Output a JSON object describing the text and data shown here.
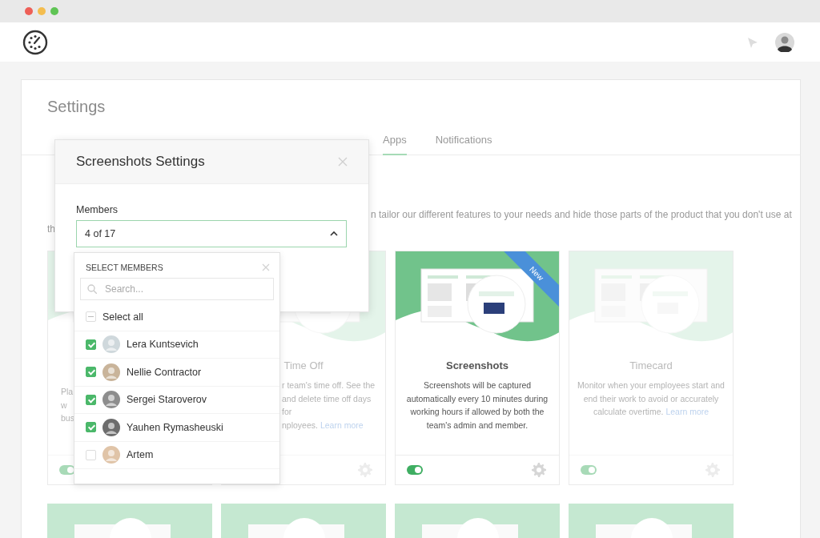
{
  "settings": {
    "title": "Settings",
    "tabs": [
      {
        "label": "Apps",
        "selected": true
      },
      {
        "label": "Notifications",
        "selected": false
      }
    ],
    "intro": [
      "n tailor our different features to your needs and hide those parts of the product that you don't use at",
      "th"
    ]
  },
  "cards": [
    {
      "lines": [
        "Pla",
        "w",
        "bus"
      ],
      "dimmed": true,
      "on": true
    },
    {
      "title": "Time Off",
      "lines": [
        "r team's time off. See the",
        "and delete time off days for",
        "nployees."
      ],
      "link": "Learn more",
      "dimmed": true
    },
    {
      "title": "Screenshots",
      "lines": [
        "Screenshots will be captured",
        "automatically every 10 minutes during",
        "working hours if allowed by both the",
        "team's admin and member."
      ],
      "dimmed": false,
      "on": true,
      "badge": "New"
    },
    {
      "title": "Timecard",
      "lines": [
        "Monitor when your employees start and",
        "end their work to avoid or accurately",
        "calculate overtime."
      ],
      "link": "Learn more",
      "dimmed": true,
      "on": true
    }
  ],
  "modal": {
    "title": "Screenshots Settings",
    "field_label": "Members",
    "value": "4 of 17",
    "expanded": true
  },
  "dropdown": {
    "title": "SELECT MEMBERS",
    "placeholder": "Search...",
    "select_all": {
      "label": "Select all",
      "indeterminate": true
    },
    "members": [
      {
        "name": "Lera Kuntsevich",
        "checked": true
      },
      {
        "name": "Nellie Contractor",
        "checked": true
      },
      {
        "name": "Sergei Staroverov",
        "checked": true
      },
      {
        "name": "Yauhen Rymasheuski",
        "checked": true
      },
      {
        "name": "Artem",
        "checked": false
      }
    ]
  }
}
